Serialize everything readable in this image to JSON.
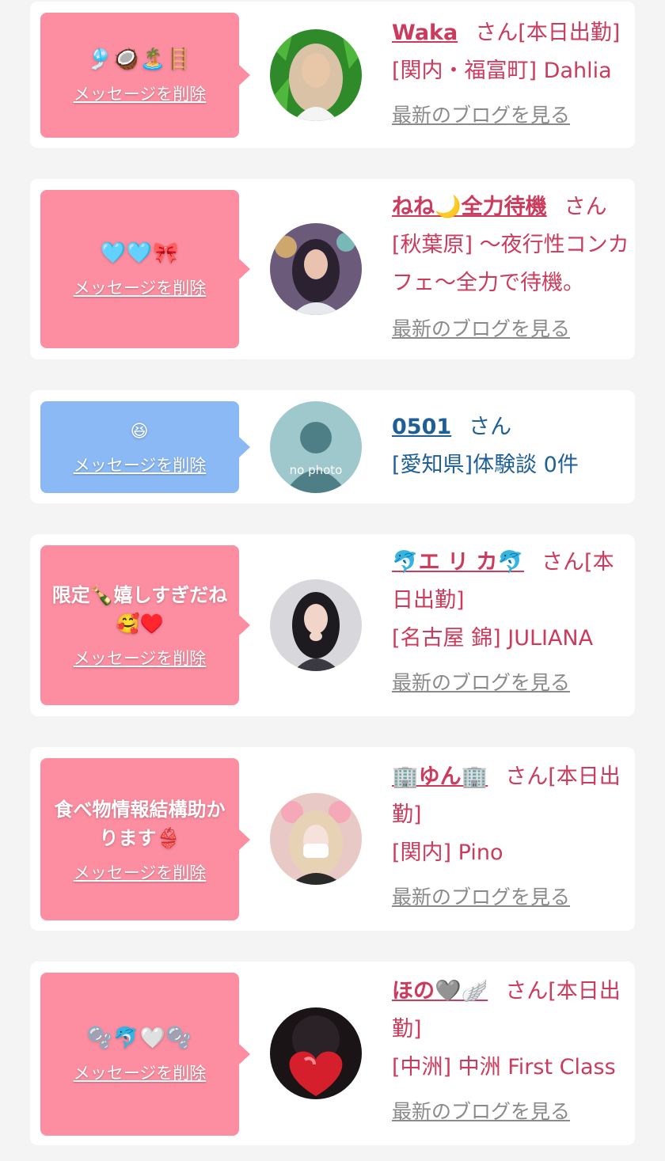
{
  "colors": {
    "pink_bubble": "#fd8ea1",
    "blue_bubble": "#8ab9f6",
    "name_pink": "#cc3a5c",
    "name_blue": "#1e5f9a",
    "link_gray": "#8a8a8a"
  },
  "entries": [
    {
      "message": "🎐🥥🏝️🪜",
      "delete_label": "メッセージを削除",
      "name": "Waka",
      "honorific": "さん",
      "status": "[本日出勤]",
      "shop": "[関内・福富町] Dahlia",
      "blog_label": "最新のブログを見る",
      "avatar": "photo"
    },
    {
      "message": "🩵🩵🎀",
      "delete_label": "メッセージを削除",
      "name": "ねね🌙全力待機",
      "honorific": "さん",
      "shop": "[秋葉原] 〜夜行性コンカフェ〜全力で待機。",
      "blog_label": "最新のブログを見る",
      "avatar": "photo"
    },
    {
      "message": "😆",
      "delete_label": "メッセージを削除",
      "name": "0501",
      "honorific": "さん",
      "shop": "[愛知県]体験談 0件",
      "avatar": "no-photo",
      "avatar_text": "no photo"
    },
    {
      "message": "限定🍾嬉しすぎだね🥰♥️",
      "delete_label": "メッセージを削除",
      "name": "🐬エ リ カ🐬",
      "honorific": "さん",
      "status": "[本日出勤]",
      "shop": "[名古屋 錦] JULIANA",
      "blog_label": "最新のブログを見る",
      "avatar": "photo"
    },
    {
      "message": "食べ物情報結構助かります👙",
      "delete_label": "メッセージを削除",
      "name": "🏢ゆん🏢",
      "honorific": "さん",
      "status": "[本日出勤]",
      "shop": "[関内] Pino",
      "blog_label": "最新のブログを見る",
      "avatar": "photo"
    },
    {
      "message": "🫧🐬🤍🫧",
      "delete_label": "メッセージを削除",
      "name": "ほの🩶🪽",
      "honorific": "さん",
      "status": "[本日出勤]",
      "shop": "[中洲] 中洲 First Class",
      "blog_label": "最新のブログを見る",
      "avatar": "photo"
    }
  ]
}
